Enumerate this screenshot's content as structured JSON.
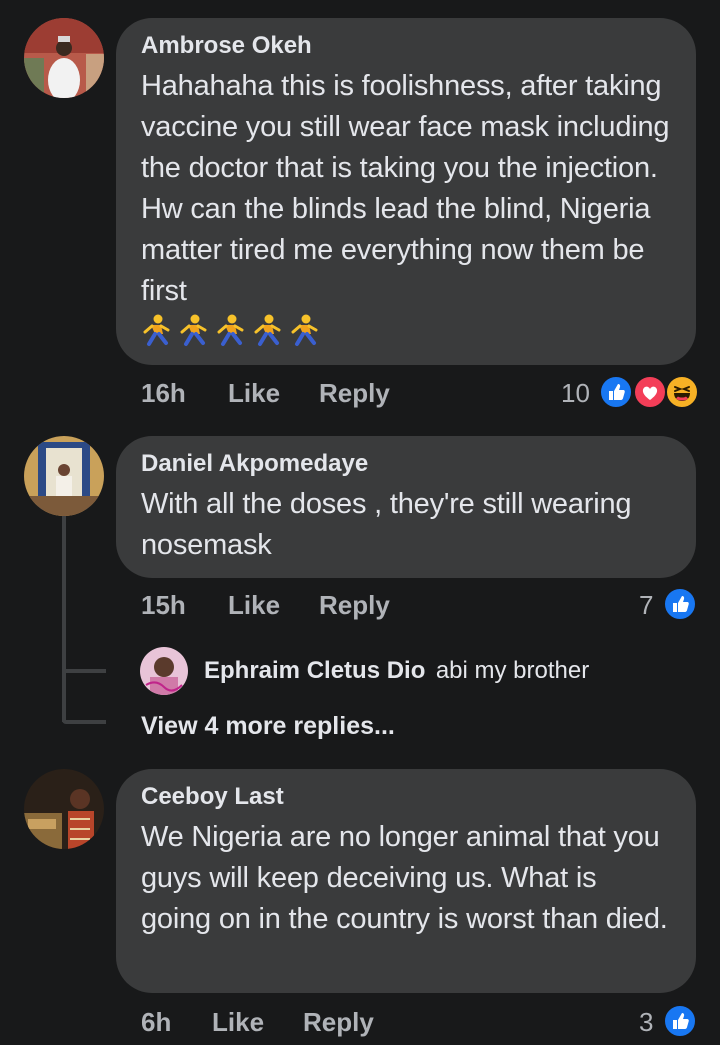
{
  "comments": [
    {
      "author": "Ambrose Okeh",
      "text": "Hahahaha this is foolishness, after taking vaccine you still wear face mask including the doctor that is taking you the injection. Hw can the blinds lead the blind, Nigeria matter tired me everything now them be first",
      "emoji": "running-man-emoji x5",
      "time": "16h",
      "like_label": "Like",
      "reply_label": "Reply",
      "reaction_count": "10",
      "reactions": [
        "like",
        "love",
        "haha"
      ]
    },
    {
      "author": "Daniel Akpomedaye",
      "text": "With all the doses , they're still wearing nosemask",
      "time": "15h",
      "like_label": "Like",
      "reply_label": "Reply",
      "reaction_count": "7",
      "reactions": [
        "like"
      ],
      "reply_preview": {
        "author": "Ephraim Cletus Dio",
        "text": "abi my brother"
      },
      "view_more": "View 4 more replies..."
    },
    {
      "author": "Ceeboy Last",
      "text": "We Nigeria are no longer animal that you guys will keep deceiving us. What is going on in the country is worst than died.",
      "time": "6h",
      "like_label": "Like",
      "reply_label": "Reply",
      "reaction_count": "3",
      "reactions": [
        "like"
      ]
    }
  ],
  "colors": {
    "background": "#18191a",
    "bubble": "#3a3b3c",
    "meta_text": "#b0b3b8",
    "like_blue": "#1877f2",
    "love_red": "#f33e58",
    "haha_yellow": "#f7b125"
  }
}
